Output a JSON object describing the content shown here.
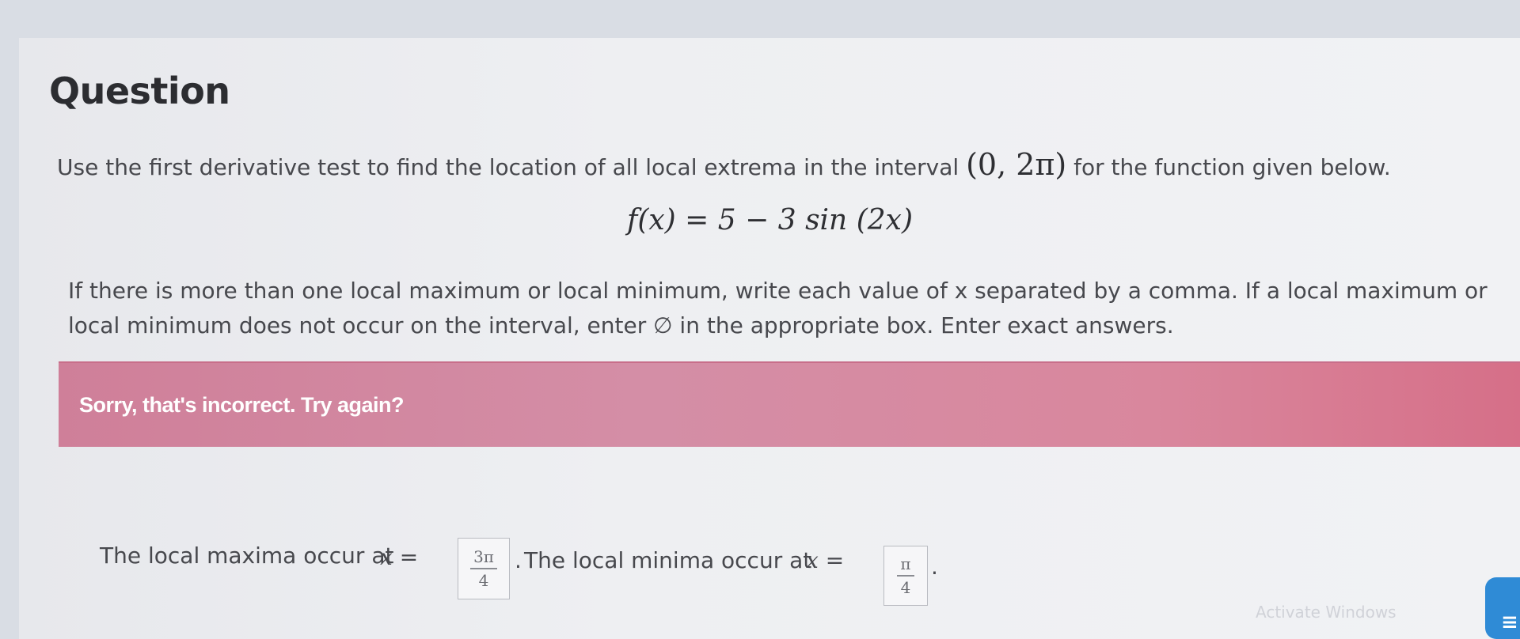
{
  "question": {
    "title": "Question",
    "prompt_text": "Use the first derivative test to find the location of all local extrema in the interval",
    "interval": "(0, 2π)",
    "prompt_tail": "for the function given below.",
    "function": "f(x) = 5 − 3 sin (2x)",
    "instructions": "If there is more than one local maximum or local minimum, write each value of x separated by a comma. If a local maximum or local minimum does not occur on the interval, enter ∅ in the appropriate box. Enter exact answers."
  },
  "feedback": {
    "message": "Sorry, that's incorrect. Try again?"
  },
  "answers": {
    "maxima_label": "The local maxima occur at",
    "maxima_var": "x =",
    "maxima_num": "3π",
    "maxima_den": "4",
    "separator": ".",
    "minima_label": "The local minima occur at",
    "minima_var": "x =",
    "minima_num": "π",
    "minima_den": "4",
    "end": "."
  },
  "overlay": {
    "watermark": "Activate Windows",
    "taskbar_glyph": "≡"
  }
}
